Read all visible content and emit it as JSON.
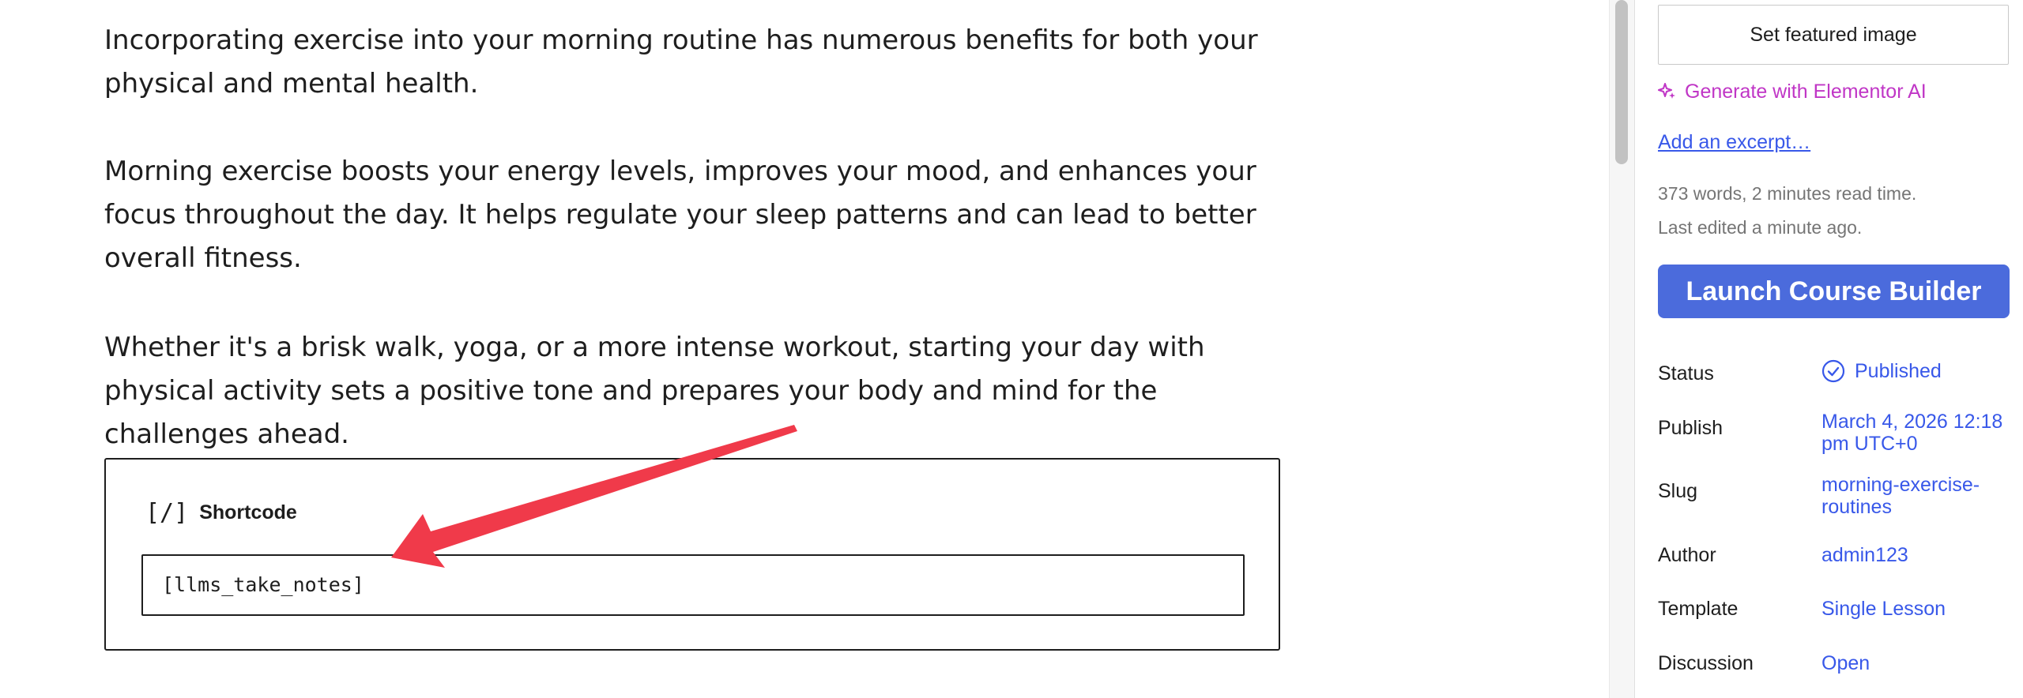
{
  "content": {
    "paragraph_1": "Incorporating exercise into your morning routine has numerous benefits for both your physical and mental health.",
    "paragraph_2": "Morning exercise boosts your energy levels, improves your mood, and enhances your focus throughout the day. It helps regulate your sleep patterns and can lead to better overall fitness.",
    "paragraph_3": "Whether it's a brisk walk, yoga, or a more intense workout, starting your day with physical activity sets a positive tone and prepares your body and mind for the challenges ahead."
  },
  "shortcode_block": {
    "icon": "[/]",
    "title": "Shortcode",
    "value": "[llms_take_notes]"
  },
  "annotation": {
    "color": "#f03a4a",
    "icon": "arrow-icon"
  },
  "sidebar": {
    "featured_image_label": "Set featured image",
    "ai_label": "Generate with Elementor AI",
    "ai_icon": "sparkle-icon",
    "excerpt_label": "Add an excerpt…",
    "word_count": "373 words, 2 minutes read time.",
    "last_edited": "Last edited a minute ago.",
    "launch_label": "Launch Course Builder",
    "status": {
      "label": "Status",
      "value": "Published",
      "icon": "check-circle-icon"
    },
    "publish": {
      "label": "Publish",
      "value": "March 4, 2026 12:18 pm UTC+0"
    },
    "slug": {
      "label": "Slug",
      "value": "morning-exercise-routines"
    },
    "author": {
      "label": "Author",
      "value": "admin123"
    },
    "template": {
      "label": "Template",
      "value": "Single Lesson"
    },
    "discussion": {
      "label": "Discussion",
      "value": "Open"
    }
  },
  "colors": {
    "link": "#3858e9",
    "ai": "#c036c6",
    "launch_button": "#4b6bdc"
  }
}
